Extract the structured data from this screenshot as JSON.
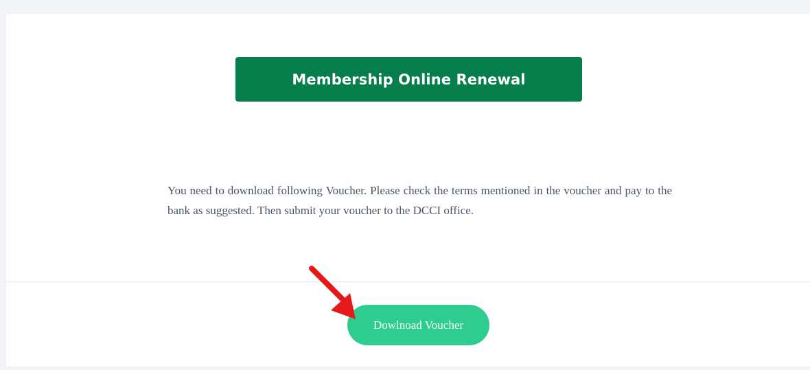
{
  "renewal": {
    "title": "Membership Online Renewal",
    "instructions": "You need to download following Voucher. Please check the terms mentioned in the voucher and pay to the bank as suggested. Then submit your voucher to the DCCI office.",
    "download_button_label": "Dowlnoad Voucher"
  },
  "annotation": {
    "icon": "red-arrow-icon"
  },
  "colors": {
    "banner": "#067e4c",
    "button": "#2ecc8f",
    "arrow": "#e61919",
    "text": "#4b5563"
  }
}
